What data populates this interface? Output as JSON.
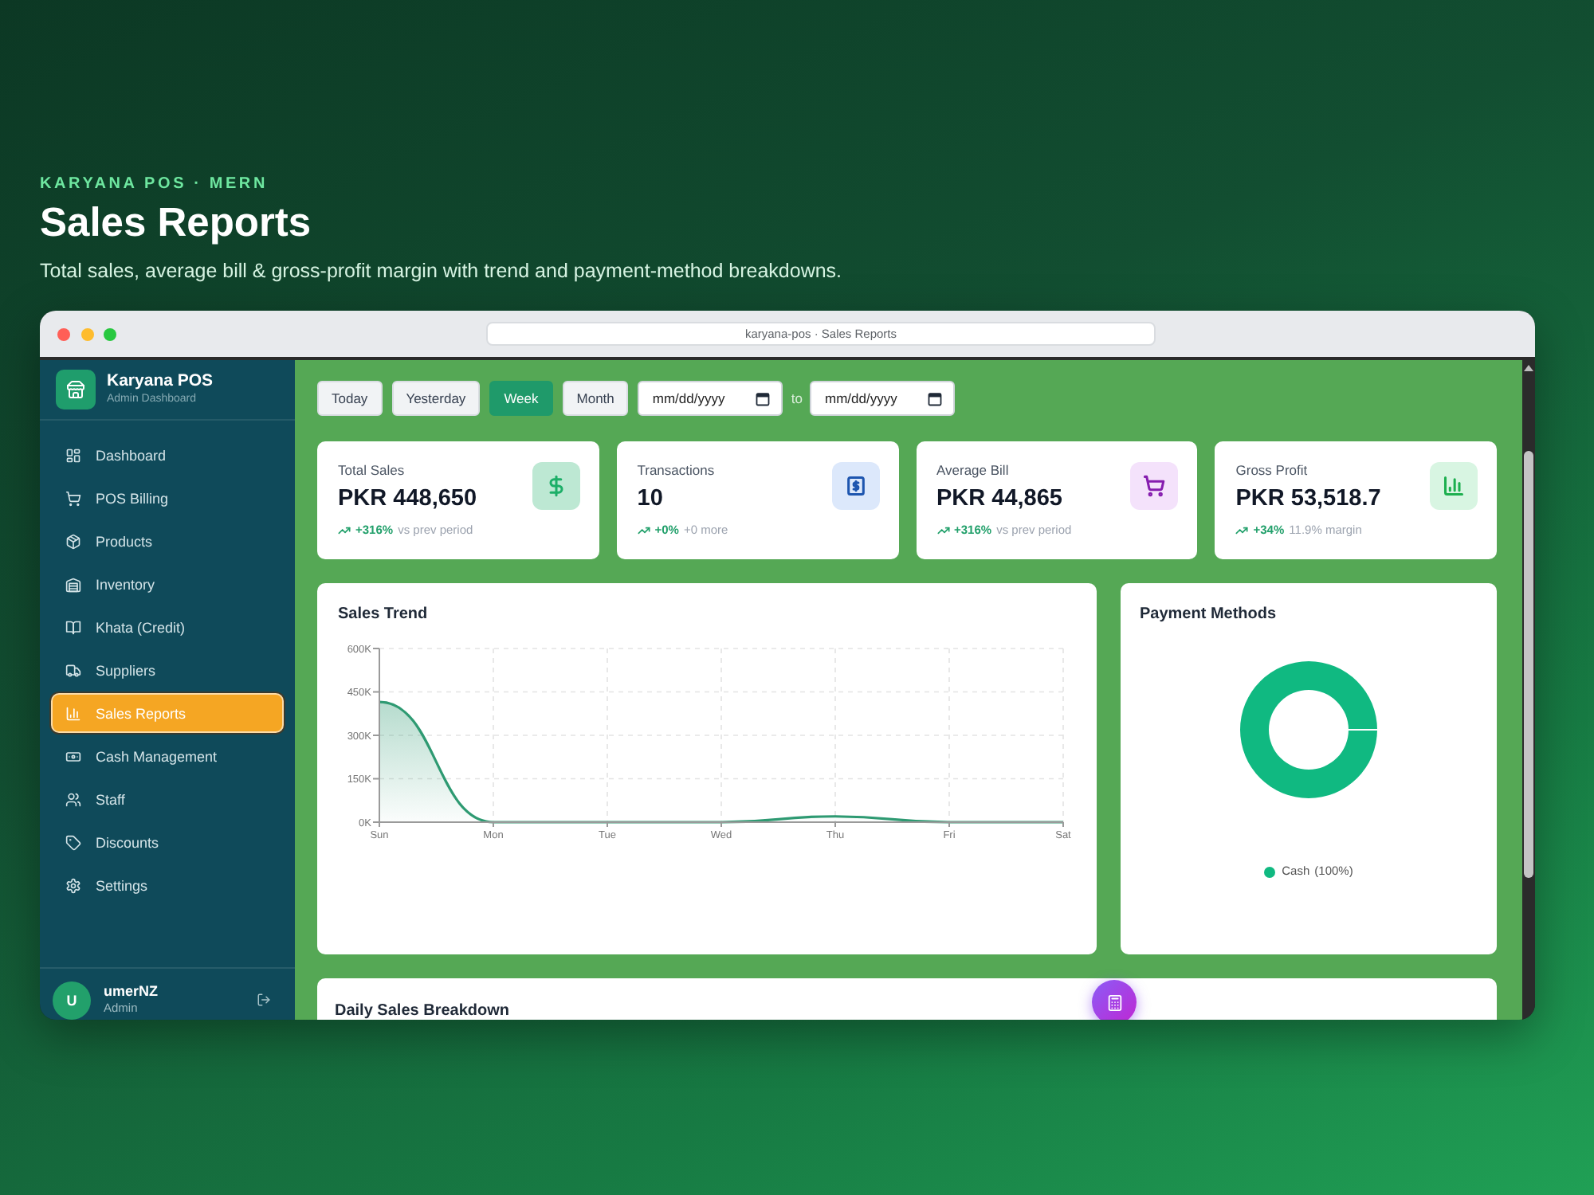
{
  "hero": {
    "eyebrow": "KARYANA POS · MERN",
    "title": "Sales Reports",
    "subtitle": "Total sales, average bill & gross-profit margin with trend and payment-method breakdowns."
  },
  "browser": {
    "address": "karyana-pos · Sales Reports"
  },
  "sidebar": {
    "brand": {
      "name": "Karyana POS",
      "subtitle": "Admin Dashboard"
    },
    "items": [
      {
        "label": "Dashboard",
        "selected": false
      },
      {
        "label": "POS Billing",
        "selected": false
      },
      {
        "label": "Products",
        "selected": false
      },
      {
        "label": "Inventory",
        "selected": false
      },
      {
        "label": "Khata (Credit)",
        "selected": false
      },
      {
        "label": "Suppliers",
        "selected": false
      },
      {
        "label": "Sales Reports",
        "selected": true
      },
      {
        "label": "Cash Management",
        "selected": false
      },
      {
        "label": "Staff",
        "selected": false
      },
      {
        "label": "Discounts",
        "selected": false
      },
      {
        "label": "Settings",
        "selected": false
      }
    ],
    "user": {
      "initial": "U",
      "name": "umerNZ",
      "role": "Admin"
    }
  },
  "filters": {
    "ranges": [
      {
        "label": "Today",
        "selected": false
      },
      {
        "label": "Yesterday",
        "selected": false
      },
      {
        "label": "Week",
        "selected": true
      },
      {
        "label": "Month",
        "selected": false
      }
    ],
    "date_from": {
      "placeholder": "mm/dd/yyyy"
    },
    "separator": "to",
    "date_to": {
      "placeholder": "mm/dd/yyyy"
    }
  },
  "stats": [
    {
      "label": "Total Sales",
      "value": "PKR 448,650",
      "change": "+316%",
      "note": "vs prev period",
      "color": "#bde8d3"
    },
    {
      "label": "Transactions",
      "value": "10",
      "change": "+0%",
      "note": "+0 more",
      "color": "#dce8fb"
    },
    {
      "label": "Average Bill",
      "value": "PKR 44,865",
      "change": "+316%",
      "note": "vs prev period",
      "color": "#f4e2fb"
    },
    {
      "label": "Gross Profit",
      "value": "PKR 53,518.7",
      "change": "+34%",
      "note": "11.9% margin",
      "color": "#d8f5e2"
    }
  ],
  "sales_trend": {
    "chart_data": {
      "type": "area",
      "title": "Sales Trend",
      "categories": [
        "Sun",
        "Mon",
        "Tue",
        "Wed",
        "Thu",
        "Fri",
        "Sat"
      ],
      "series": [
        {
          "color": "#2e9a72",
          "values": [
            415000,
            0,
            0,
            0,
            20000,
            0,
            0
          ]
        }
      ],
      "ylim": [
        0,
        600000
      ],
      "yticks": [
        {
          "value": 0,
          "label": "0K"
        },
        {
          "value": 150000,
          "label": "150K"
        },
        {
          "value": 300000,
          "label": "300K"
        },
        {
          "value": 450000,
          "label": "450K"
        },
        {
          "value": 600000,
          "label": "600K"
        }
      ],
      "grid": true
    }
  },
  "payment_methods": {
    "title": "Payment Methods",
    "legend": [
      {
        "label": "Cash",
        "share": "(100%)",
        "color": "#10b981"
      }
    ]
  },
  "daily_breakdown": {
    "title": "Daily Sales Breakdown"
  }
}
